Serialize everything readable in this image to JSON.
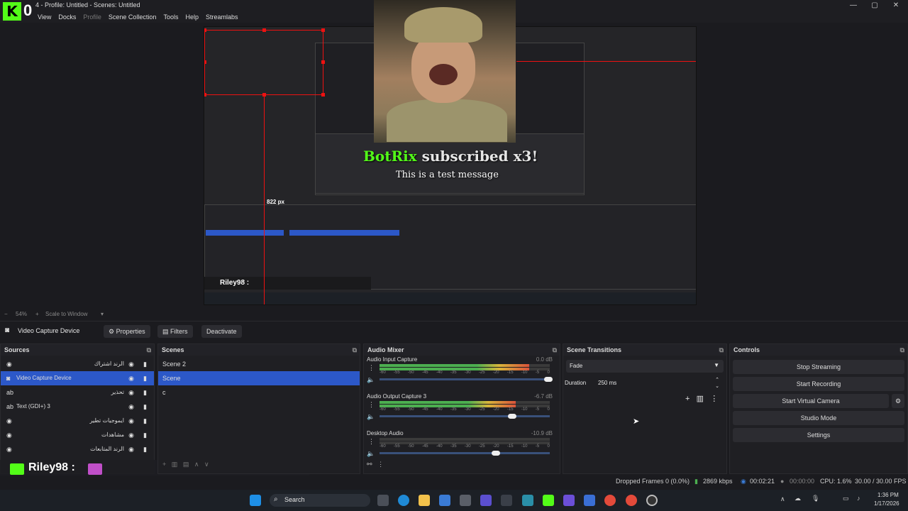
{
  "titlebar": {
    "title": "4 - Profile: Untitled - Scenes: Untitled",
    "kick_count": "0"
  },
  "menu": [
    "View",
    "Docks",
    "Profile",
    "Scene Collection",
    "Tools",
    "Help",
    "Streamlabs"
  ],
  "preview": {
    "size_label": "822 px",
    "alert": {
      "name": "BotRix",
      "text": "subscribed x3!",
      "message": "This is a test message"
    },
    "chat_overlay": "Riley98 :"
  },
  "zoom": {
    "value": "54%",
    "mode": "Scale to Window"
  },
  "source_toolbar": {
    "source_name": "Video Capture Device",
    "properties": "Properties",
    "filters": "Filters",
    "deactivate": "Deactivate"
  },
  "sources": {
    "title": "Sources",
    "items": [
      {
        "label": "الرند اشتراك",
        "icon": "globe-icon"
      },
      {
        "label": "Video Capture Device",
        "icon": "camera-icon",
        "selected": true
      },
      {
        "label": "تحذير",
        "icon": "text-icon"
      },
      {
        "label": "Text (GDI+) 3",
        "icon": "text-icon"
      },
      {
        "label": "ايموجيات تطير",
        "icon": "globe-icon"
      },
      {
        "label": "مشاهدات",
        "icon": "globe-icon"
      },
      {
        "label": "الرند المتابعات",
        "icon": "globe-icon"
      }
    ]
  },
  "scenes": {
    "title": "Scenes",
    "items": [
      "Scene 2",
      "Scene",
      "c"
    ],
    "selected": 1
  },
  "mixer": {
    "title": "Audio Mixer",
    "channels": [
      {
        "name": "Audio Input Capture",
        "db": "0.0 dB",
        "level": 0.88,
        "volume": 1.0
      },
      {
        "name": "Audio Output Capture 3",
        "db": "-6.7 dB",
        "level": 0.8,
        "volume": 0.78
      },
      {
        "name": "Desktop Audio",
        "db": "-10.9 dB",
        "level": 0.0,
        "volume": 0.68
      }
    ],
    "ticks": [
      "-60",
      "-55",
      "-50",
      "-45",
      "-40",
      "-35",
      "-30",
      "-25",
      "-20",
      "-15",
      "-10",
      "-5",
      "0"
    ]
  },
  "transitions": {
    "title": "Scene Transitions",
    "selected": "Fade",
    "duration_label": "Duration",
    "duration": "250 ms"
  },
  "controls": {
    "title": "Controls",
    "buttons": [
      "Stop Streaming",
      "Start Recording",
      "Start Virtual Camera",
      "Studio Mode",
      "Settings"
    ]
  },
  "status": {
    "dropped": "Dropped Frames 0 (0.0%)",
    "kbps": "2869 kbps",
    "stream_time": "00:02:21",
    "rec_time": "00:00:00",
    "cpu": "CPU: 1.6%",
    "fps": "30.00 / 30.00 FPS"
  },
  "taskbar": {
    "search": "Search",
    "time": "1:36 PM",
    "date": "1/17/2026"
  }
}
